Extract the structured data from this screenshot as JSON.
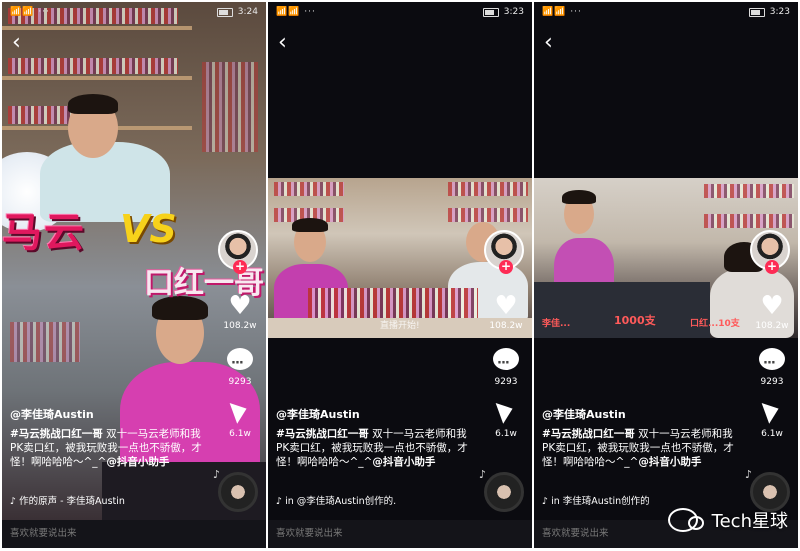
{
  "statusbar": [
    {
      "signal": "📶📶 ···",
      "time": "3:24"
    },
    {
      "signal": "📶📶 ···",
      "time": "3:23"
    },
    {
      "signal": "📶📶 ···",
      "time": "3:23"
    }
  ],
  "video1": {
    "title_left": "马云",
    "title_vs": "VS",
    "title_right": "口红一哥"
  },
  "video2": {
    "overlay": "直播开始!"
  },
  "video3": {
    "overlay_left": "李佳...",
    "overlay_mid": "1000支",
    "overlay_right": "口红...10支"
  },
  "actions": [
    {
      "likes": "108.2w",
      "comments": "9293",
      "shares": "6.1w"
    },
    {
      "likes": "108.2w",
      "comments": "9293",
      "shares": "6.1w"
    },
    {
      "likes": "108.2w",
      "comments": "9293",
      "shares": "6.1w"
    }
  ],
  "post": {
    "author": "@李佳琦Austin",
    "hashtag": "#马云挑战口红一哥",
    "caption": " 双十一马云老师和我PK卖口红，被我玩败我一点也不骄傲，才怪！啊哈哈哈～^_^",
    "mention": "@抖音小助手"
  },
  "music": [
    "♪ 作的原声 - 李佳琦Austin",
    "♪ in   @李佳琦Austin创作的.",
    "♪ in   李佳琦Austin创作的"
  ],
  "comment_placeholder": "喜欢就要说出来",
  "watermark": "Tech星球"
}
